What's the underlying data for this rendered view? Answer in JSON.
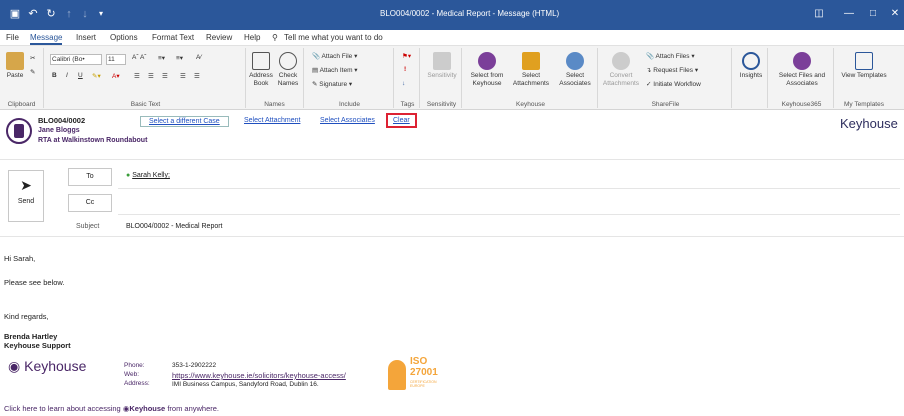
{
  "window": {
    "title": "BLO004/0002 - Medical Report - Message (HTML)"
  },
  "menu": {
    "items": [
      "File",
      "Message",
      "Insert",
      "Options",
      "Format Text",
      "Review",
      "Help"
    ],
    "tell_me": "Tell me what you want to do"
  },
  "ribbon": {
    "clipboard": {
      "paste": "Paste",
      "label": "Clipboard"
    },
    "basic_text": {
      "font": "Calibri (Bo•",
      "size": "11",
      "label": "Basic Text"
    },
    "names": {
      "address_book": "Address Book",
      "check_names": "Check Names",
      "label": "Names"
    },
    "include": {
      "attach_file": "Attach File",
      "attach_item": "Attach Item",
      "signature": "Signature",
      "label": "Include"
    },
    "tags": {
      "label": "Tags"
    },
    "sensitivity": {
      "label": "Sensitivity",
      "btn": "Sensitivity"
    },
    "keyhouse": {
      "select_from": "Select from Keyhouse",
      "select_attachments": "Select Attachments",
      "select_associates": "Select Associates",
      "label": "Keyhouse"
    },
    "sharefile": {
      "convert": "Convert Attachments",
      "attach_files": "Attach Files",
      "request_files": "Request Files",
      "initiate_workflow": "Initiate Workflow",
      "label": "ShareFile"
    },
    "insights": {
      "label": "Insights"
    },
    "keyhouse365": {
      "select_files": "Select Files and Associates",
      "label": "Keyhouse365"
    },
    "my_templates": {
      "view": "View Templates",
      "label": "My Templates"
    }
  },
  "case": {
    "ref": "BLO004/0002",
    "client": "Jane Bloggs",
    "desc": "RTA at Walkinstown Roundabout",
    "link_case": "Select a different Case",
    "link_attach": "Select Attachment",
    "link_assoc": "Select Associates",
    "link_clear": "Clear",
    "brand": "Keyhouse"
  },
  "compose": {
    "send": "Send",
    "to": "To",
    "cc": "Cc",
    "subject_label": "Subject",
    "to_value": "Sarah Kelly;",
    "subject_value": "BLO004/0002 - Medical Report"
  },
  "body": {
    "greeting": "Hi Sarah,",
    "line1": "Please see below.",
    "closing": "Kind regards,",
    "name": "Brenda Hartley",
    "org": "Keyhouse Support",
    "sig_brand": "Keyhouse",
    "phone_label": "Phone:",
    "web_label": "Web:",
    "address_label": "Address:",
    "phone": "353-1-2902222",
    "web": "https://www.keyhouse.ie/solicitors/keyhouse-access/",
    "address": "IMI Business Campus, Sandyford Road, Dublin 16.",
    "iso": "ISO",
    "iso_num": "27001",
    "iso_sub": "CERTIFICATION EUROPE",
    "footer_pre": "Click here to learn about accessing",
    "footer_brand": "Keyhouse",
    "footer_post": "from anywhere."
  }
}
